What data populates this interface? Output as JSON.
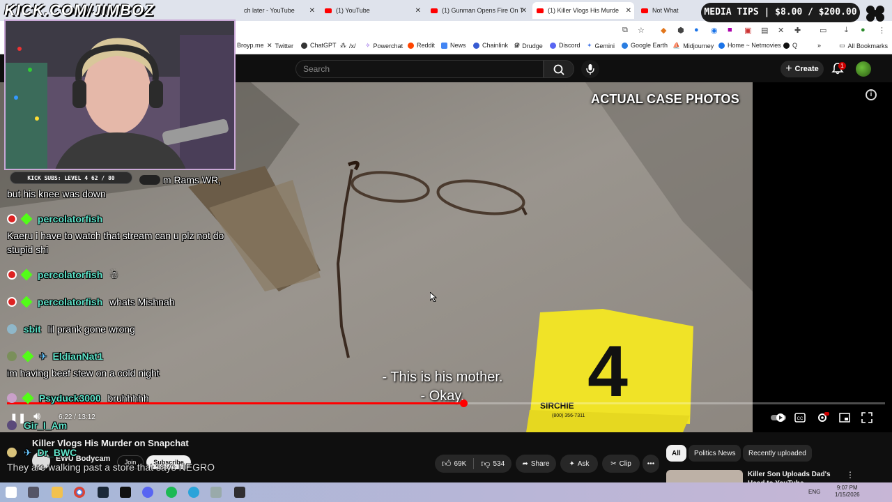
{
  "browser": {
    "tabs": [
      {
        "label": "ch later - YouTube"
      },
      {
        "label": "(1) YouTube"
      },
      {
        "label": "(1) Gunman Opens Fire On T"
      },
      {
        "label": "(1) Killer Vlogs His Murde"
      },
      {
        "label": "Not What"
      }
    ],
    "bookmarks": [
      {
        "label": "Broyp.me"
      },
      {
        "label": "Twitter"
      },
      {
        "label": "ChatGPT"
      },
      {
        "label": "/x/"
      },
      {
        "label": "Powerchat"
      },
      {
        "label": "Reddit"
      },
      {
        "label": "News"
      },
      {
        "label": "Chainlink"
      },
      {
        "label": "Drudge"
      },
      {
        "label": "Discord"
      },
      {
        "label": "Gemini"
      },
      {
        "label": "Google Earth"
      },
      {
        "label": "Midjourney"
      },
      {
        "label": "Home ~ Netmovies"
      },
      {
        "label": "Q"
      }
    ],
    "all_bookmarks": "All Bookmarks"
  },
  "youtube": {
    "search_placeholder": "Search",
    "create_label": "Create",
    "notification_count": "1"
  },
  "video": {
    "overlay_label": "ACTUAL CASE PHOTOS",
    "subtitle_line1": "- This is his mother.",
    "subtitle_line2": "- Okay.",
    "marker_number": "4",
    "marker_brand": "SIRCHIE",
    "marker_phone": "(800) 356-7311",
    "time_current": "6:22",
    "time_total": "13:12",
    "time_display": "6:22 / 13:12",
    "progress_fraction": 0.52
  },
  "below_video": {
    "title": "Killer Vlogs His Murder on Snapchat",
    "channel_name": "EWU Bodycam",
    "join_label": "Join",
    "subscribe_label": "Subscribe",
    "likes": "69K",
    "dislikes": "534",
    "share_label": "Share",
    "ask_label": "Ask",
    "clip_label": "Clip",
    "chips": [
      "All",
      "Politics News",
      "Recently uploaded"
    ],
    "rec_title": "Killer Son Uploads Dad's Head to YouTube"
  },
  "stream": {
    "banner": "KICK.COM/JIMBOZ",
    "subs_bar": "KICK SUBS: LEVEL 4 62 / 80",
    "media_tips": "MEDIA TIPS | $8.00 / $200.00",
    "overlay_caption": "They are walking past a store that says NEGRO",
    "chat": [
      {
        "user": "",
        "text": "m Rams WR,"
      },
      {
        "user": "",
        "text": "but his knee was down"
      },
      {
        "user": "percolatorfish",
        "text": ""
      },
      {
        "user": "",
        "text": "Kaeru i have to watch that stream can u plz not do stupid shi"
      },
      {
        "user": "percolatorfish",
        "text": ""
      },
      {
        "user": "percolatorfish",
        "text": "whats Mishnah"
      },
      {
        "user": "sbit",
        "text": "lil prank gone wrong"
      },
      {
        "user": "EldianNat1",
        "text": ""
      },
      {
        "user": "",
        "text": "im having beef stew on a cold night"
      },
      {
        "user": "Psyduck3000",
        "text": "bruhhhhh"
      },
      {
        "user": "Gir_I_Am",
        "text": ""
      },
      {
        "user": "Dr_BWC",
        "text": ""
      }
    ]
  },
  "taskbar": {
    "lang": "ENG",
    "time": "9:07 PM",
    "date": "1/15/2026"
  },
  "colors": {
    "accent_red": "#ff0000",
    "kick_green": "#53fc18",
    "username_teal": "#5fe3c9"
  }
}
